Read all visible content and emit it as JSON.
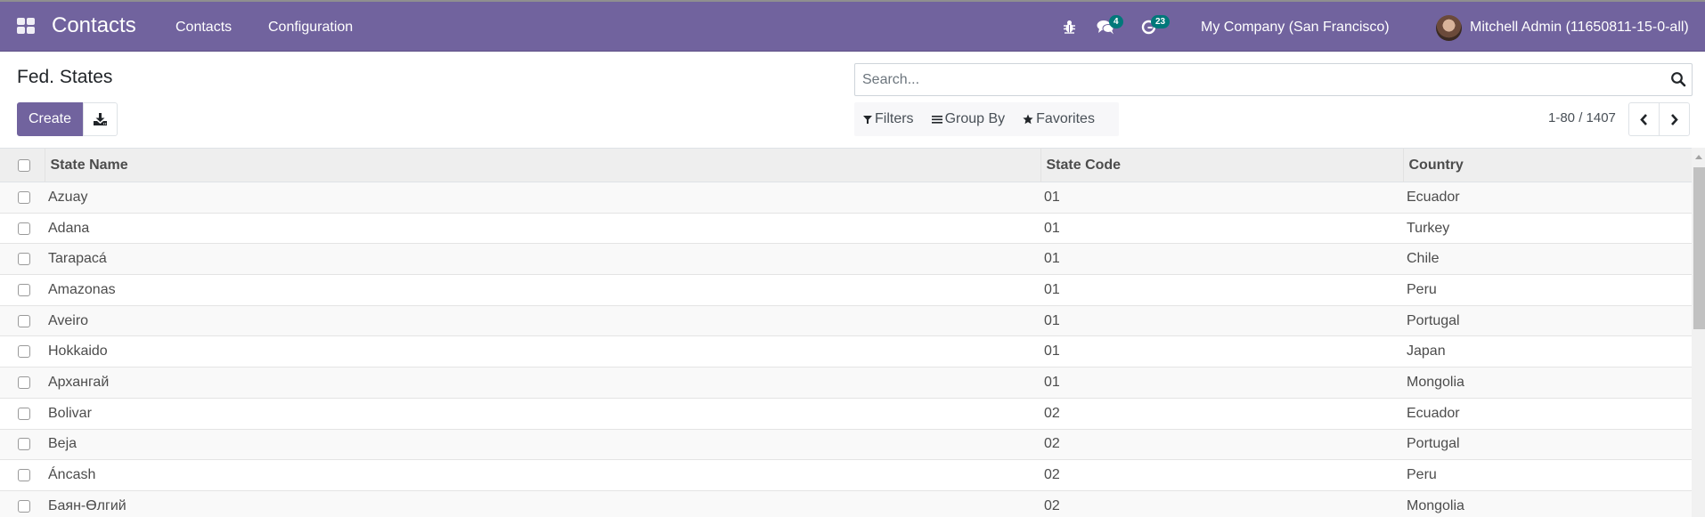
{
  "navbar": {
    "app_name": "Contacts",
    "menu": [
      {
        "label": "Contacts"
      },
      {
        "label": "Configuration"
      }
    ],
    "systray": {
      "debug_icon": "bug-icon",
      "messages_icon": "comments-icon",
      "messages_count": "4",
      "activities_icon": "clock-icon",
      "activities_count": "23"
    },
    "company": "My Company (San Francisco)",
    "user": "Mitchell Admin (11650811-15-0-all)"
  },
  "control_panel": {
    "title": "Fed. States",
    "create_label": "Create",
    "download_icon": "download-icon",
    "search": {
      "placeholder": "Search...",
      "value": ""
    },
    "filters_label": "Filters",
    "group_by_label": "Group By",
    "favorites_label": "Favorites",
    "pager": "1-80 / 1407"
  },
  "table": {
    "columns": [
      "State Name",
      "State Code",
      "Country"
    ],
    "rows": [
      {
        "name": "Azuay",
        "code": "01",
        "country": "Ecuador"
      },
      {
        "name": "Adana",
        "code": "01",
        "country": "Turkey"
      },
      {
        "name": "Tarapacá",
        "code": "01",
        "country": "Chile"
      },
      {
        "name": "Amazonas",
        "code": "01",
        "country": "Peru"
      },
      {
        "name": "Aveiro",
        "code": "01",
        "country": "Portugal"
      },
      {
        "name": "Hokkaido",
        "code": "01",
        "country": "Japan"
      },
      {
        "name": "Архангай",
        "code": "01",
        "country": "Mongolia"
      },
      {
        "name": "Bolivar",
        "code": "02",
        "country": "Ecuador"
      },
      {
        "name": "Beja",
        "code": "02",
        "country": "Portugal"
      },
      {
        "name": "Áncash",
        "code": "02",
        "country": "Peru"
      },
      {
        "name": "Баян-Өлгий",
        "code": "02",
        "country": "Mongolia"
      }
    ]
  },
  "colors": {
    "brand": "#71639e",
    "badge": "#00787a"
  }
}
